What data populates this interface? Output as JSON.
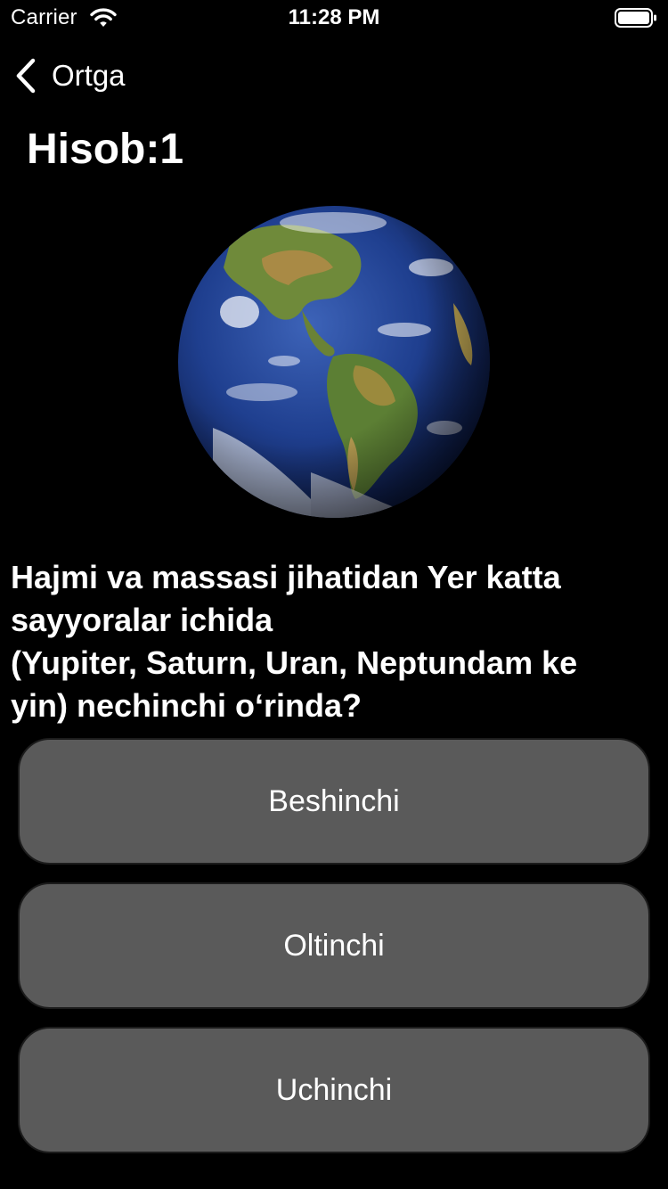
{
  "status_bar": {
    "carrier": "Carrier",
    "time": "11:28 PM",
    "icons": [
      "wifi-icon",
      "battery-icon"
    ]
  },
  "nav": {
    "back_label": "Ortga",
    "back_icon": "chevron-left-icon"
  },
  "score": {
    "text": "Hisob:1"
  },
  "image": {
    "icon": "earth-globe-image"
  },
  "question": {
    "lines": [
      "Hajmi va massasi jihatidan Yer katta",
      "sayyoralar ichida",
      "(Yupiter, Saturn, Uran, Neptundam ke",
      "yin) nechinchi oʻrinda?"
    ]
  },
  "answers": [
    {
      "label": "Beshinchi"
    },
    {
      "label": "Oltinchi"
    },
    {
      "label": "Uchinchi"
    }
  ],
  "colors": {
    "background": "#000000",
    "answer_button": "#5a5a5a",
    "text": "#ffffff"
  }
}
